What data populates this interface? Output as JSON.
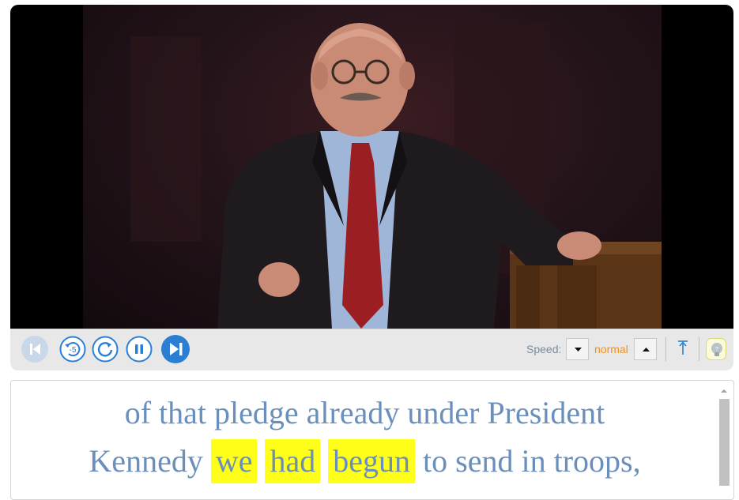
{
  "video": {
    "accent": "#2a7fd4"
  },
  "controls": {
    "buttons": [
      {
        "name": "previous-caption-button",
        "icon": "skip-back-icon",
        "enabled": false
      },
      {
        "name": "replay-5-seconds-button",
        "icon": "rewind-5-icon",
        "label": "-5"
      },
      {
        "name": "repeat-caption-button",
        "icon": "repeat-icon"
      },
      {
        "name": "pause-button",
        "icon": "pause-icon"
      },
      {
        "name": "next-caption-button",
        "icon": "skip-forward-icon"
      }
    ],
    "speed_label": "Speed:",
    "speed_value": "normal",
    "speed_value_color": "#f0901e"
  },
  "transcript": {
    "lines": [
      [
        {
          "text": "of",
          "highlighted": false
        },
        {
          "text": "that",
          "highlighted": false
        },
        {
          "text": "pledge",
          "highlighted": false
        },
        {
          "text": "already",
          "highlighted": false
        },
        {
          "text": "under",
          "highlighted": false
        },
        {
          "text": "President",
          "highlighted": false
        }
      ],
      [
        {
          "text": "Kennedy",
          "highlighted": false
        },
        {
          "text": "we",
          "highlighted": true
        },
        {
          "text": "had",
          "highlighted": true
        },
        {
          "text": "begun",
          "highlighted": true
        },
        {
          "text": "to",
          "highlighted": false
        },
        {
          "text": "send",
          "highlighted": false
        },
        {
          "text": "in",
          "highlighted": false
        },
        {
          "text": "troops,",
          "highlighted": false
        }
      ]
    ],
    "text_color": "#6a8fbb",
    "highlight_color": "#ffff1a"
  }
}
